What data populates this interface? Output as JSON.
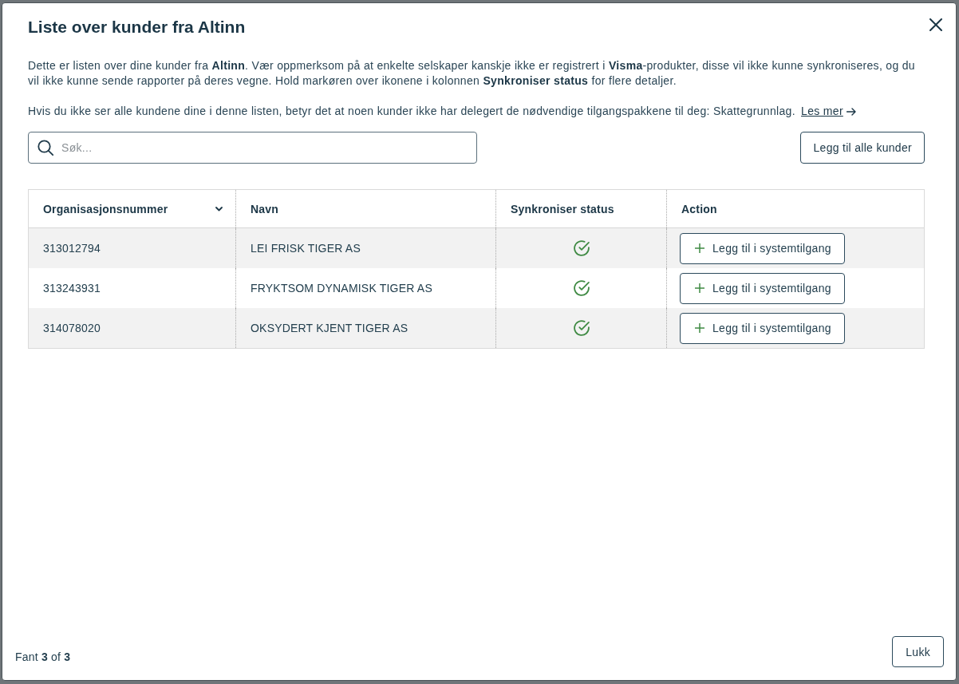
{
  "dialog": {
    "title": "Liste over kunder fra Altinn"
  },
  "intro": {
    "text": "Dette er listen over dine kunder fra **Altinn**. Vær oppmerksom på at enkelte selskaper kanskje ikke er registrert i **Visma**-produkter, disse vil ikke kunne synkroniseres, og du vil ikke kunne sende rapporter på deres vegne. Hold markøren over ikonene i kolonnen **Synkroniser status** for flere detaljer.",
    "notice": "Hvis du ikke ser alle kundene dine i denne listen, betyr det at noen kunder ikke har delegert de nødvendige tilgangspakkene til deg: Skattegrunnlag.",
    "link": "Les mer"
  },
  "search": {
    "placeholder": "Søk..."
  },
  "add_all_button": "Legg til alle kunder",
  "table": {
    "columns": [
      {
        "label": "Organisasjonsnummer",
        "sorted": true
      },
      {
        "label": "Navn",
        "sorted": false
      },
      {
        "label": "Synkroniser status",
        "sorted": false
      },
      {
        "label": "Action",
        "sorted": false
      }
    ],
    "rows": [
      {
        "org_number": "313012794",
        "name": "LEI FRISK TIGER AS",
        "synced": true,
        "action": "Legg til i systemtilgang"
      },
      {
        "org_number": "313243931",
        "name": "FRYKTSOM DYNAMISK TIGER AS",
        "synced": true,
        "action": "Legg til i systemtilgang"
      },
      {
        "org_number": "314078020",
        "name": "OKSYDERT KJENT TIGER AS",
        "synced": true,
        "action": "Legg til i systemtilgang"
      }
    ]
  },
  "footer": {
    "count": "Fant **3** of **3**",
    "close_button": "Lukk"
  }
}
